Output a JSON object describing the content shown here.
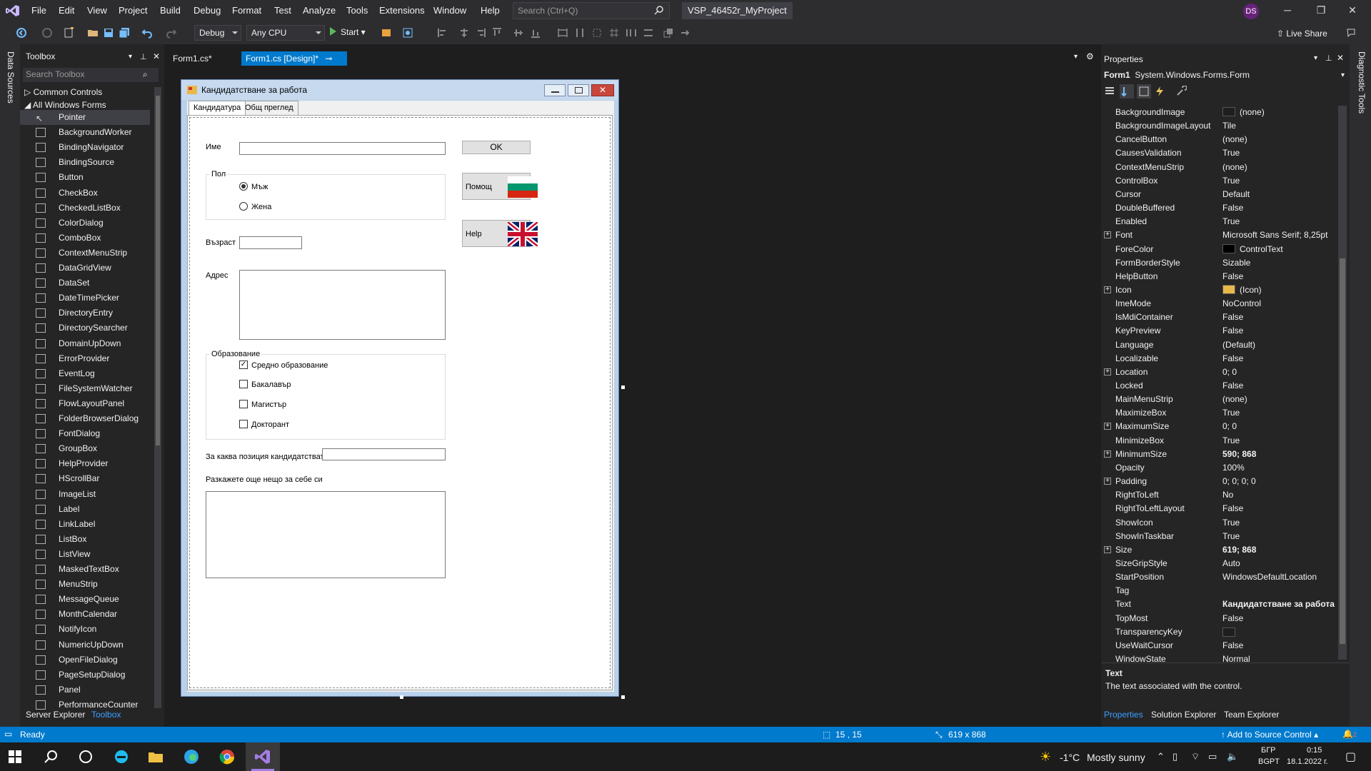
{
  "menu": [
    "File",
    "Edit",
    "View",
    "Project",
    "Build",
    "Debug",
    "Format",
    "Test",
    "Analyze",
    "Tools",
    "Extensions",
    "Window",
    "Help"
  ],
  "search": {
    "placeholder": "Search (Ctrl+Q)"
  },
  "project_title": "VSP_46452r_MyProject",
  "avatar_initials": "DS",
  "toolbar": {
    "config": "Debug",
    "platform": "Any CPU",
    "start_label": "Start",
    "live_share": "Live Share"
  },
  "left_strip_label": "Data Sources",
  "right_strip_label": "Diagnostic Tools",
  "toolbox": {
    "title": "Toolbox",
    "search_placeholder": "Search Toolbox",
    "groups": [
      "Common Controls",
      "All Windows Forms"
    ],
    "items": [
      "Pointer",
      "BackgroundWorker",
      "BindingNavigator",
      "BindingSource",
      "Button",
      "CheckBox",
      "CheckedListBox",
      "ColorDialog",
      "ComboBox",
      "ContextMenuStrip",
      "DataGridView",
      "DataSet",
      "DateTimePicker",
      "DirectoryEntry",
      "DirectorySearcher",
      "DomainUpDown",
      "ErrorProvider",
      "EventLog",
      "FileSystemWatcher",
      "FlowLayoutPanel",
      "FolderBrowserDialog",
      "FontDialog",
      "GroupBox",
      "HelpProvider",
      "HScrollBar",
      "ImageList",
      "Label",
      "LinkLabel",
      "ListBox",
      "ListView",
      "MaskedTextBox",
      "MenuStrip",
      "MessageQueue",
      "MonthCalendar",
      "NotifyIcon",
      "NumericUpDown",
      "OpenFileDialog",
      "PageSetupDialog",
      "Panel",
      "PerformanceCounter"
    ],
    "bottom_tabs": [
      "Server Explorer",
      "Toolbox"
    ]
  },
  "doc_tabs": [
    {
      "label": "Form1.cs*"
    },
    {
      "label": "Form1.cs [Design]*"
    }
  ],
  "form": {
    "title": "Кандидатстване за работа",
    "tabs": [
      "Кандидатура",
      "Общ преглед"
    ],
    "name_label": "Име",
    "ok_label": "OK",
    "gender_group": "Пол",
    "gender_options": [
      "Мъж",
      "Жена"
    ],
    "help_bg_label": "Помощ",
    "help_en_label": "Help",
    "age_label": "Възраст",
    "address_label": "Адрес",
    "education_group": "Образование",
    "education_options": [
      "Средно образование",
      "Бакалавър",
      "Магистър",
      "Докторант"
    ],
    "position_label": "За каква позиция кандидатствате?",
    "about_label": "Разкажете още нещо за себе си"
  },
  "properties": {
    "title": "Properties",
    "object_name": "Form1",
    "object_type": "System.Windows.Forms.Form",
    "rows": [
      {
        "name": "BackgroundImage",
        "value": "(none)"
      },
      {
        "name": "BackgroundImageLayout",
        "value": "Tile"
      },
      {
        "name": "CancelButton",
        "value": "(none)"
      },
      {
        "name": "CausesValidation",
        "value": "True"
      },
      {
        "name": "ContextMenuStrip",
        "value": "(none)"
      },
      {
        "name": "ControlBox",
        "value": "True"
      },
      {
        "name": "Cursor",
        "value": "Default"
      },
      {
        "name": "DoubleBuffered",
        "value": "False"
      },
      {
        "name": "Enabled",
        "value": "True"
      },
      {
        "name": "Font",
        "value": "Microsoft Sans Serif; 8,25pt"
      },
      {
        "name": "ForeColor",
        "value": "ControlText"
      },
      {
        "name": "FormBorderStyle",
        "value": "Sizable"
      },
      {
        "name": "HelpButton",
        "value": "False"
      },
      {
        "name": "Icon",
        "value": "(Icon)"
      },
      {
        "name": "ImeMode",
        "value": "NoControl"
      },
      {
        "name": "IsMdiContainer",
        "value": "False"
      },
      {
        "name": "KeyPreview",
        "value": "False"
      },
      {
        "name": "Language",
        "value": "(Default)"
      },
      {
        "name": "Localizable",
        "value": "False"
      },
      {
        "name": "Location",
        "value": "0; 0"
      },
      {
        "name": "Locked",
        "value": "False"
      },
      {
        "name": "MainMenuStrip",
        "value": "(none)"
      },
      {
        "name": "MaximizeBox",
        "value": "True"
      },
      {
        "name": "MaximumSize",
        "value": "0; 0"
      },
      {
        "name": "MinimizeBox",
        "value": "True"
      },
      {
        "name": "MinimumSize",
        "value": "590; 868"
      },
      {
        "name": "Opacity",
        "value": "100%"
      },
      {
        "name": "Padding",
        "value": "0; 0; 0; 0"
      },
      {
        "name": "RightToLeft",
        "value": "No"
      },
      {
        "name": "RightToLeftLayout",
        "value": "False"
      },
      {
        "name": "ShowIcon",
        "value": "True"
      },
      {
        "name": "ShowInTaskbar",
        "value": "True"
      },
      {
        "name": "Size",
        "value": "619; 868"
      },
      {
        "name": "SizeGripStyle",
        "value": "Auto"
      },
      {
        "name": "StartPosition",
        "value": "WindowsDefaultLocation"
      },
      {
        "name": "Tag",
        "value": ""
      },
      {
        "name": "Text",
        "value": "Кандидатстване за работа"
      },
      {
        "name": "TopMost",
        "value": "False"
      },
      {
        "name": "TransparencyKey",
        "value": ""
      },
      {
        "name": "UseWaitCursor",
        "value": "False"
      },
      {
        "name": "WindowState",
        "value": "Normal"
      }
    ],
    "desc_name": "Text",
    "desc_text": "The text associated with the control.",
    "bottom_tabs": [
      "Properties",
      "Solution Explorer",
      "Team Explorer"
    ]
  },
  "status": {
    "ready": "Ready",
    "position": "15 , 15",
    "size": "619 x 868",
    "source_control": "Add to Source Control",
    "notifications": "2"
  },
  "taskbar": {
    "weather_temp": "-1°C",
    "weather_text": "Mostly sunny",
    "lang1": "БГР",
    "lang2": "BGPT",
    "time": "0:15",
    "date": "18.1.2022 г."
  },
  "colors": {
    "accent": "#007acc",
    "vs_purple": "#68217a"
  }
}
